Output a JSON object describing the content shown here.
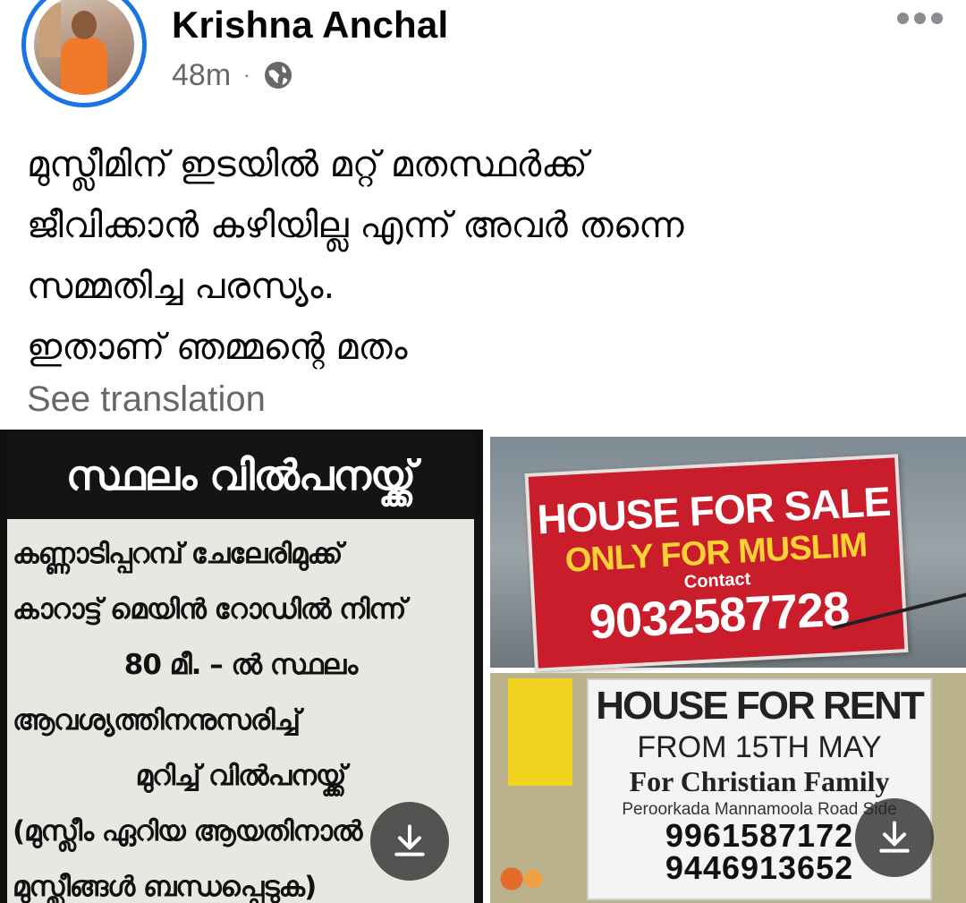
{
  "header": {
    "author_name": "Krishna Anchal",
    "time_ago": "48m",
    "separator": "·",
    "privacy_icon": "globe-icon",
    "more_icon": "more-options-icon",
    "accent_color": "#1b74e4"
  },
  "post": {
    "text_lines": [
      "മുസ്ലീമിന് ഇടയിൽ മറ്റ് മതസ്ഥർക്ക്",
      "ജീവിക്കാൻ കഴിയില്ല എന്ന് അവർ തന്നെ",
      "സമ്മതിച്ച പരസ്യം.",
      "ഇതാണ് ഞമ്മന്റെ മതം"
    ],
    "see_translation": "See translation"
  },
  "images": {
    "left": {
      "heading": "സ്ഥലം വിൽപനയ്ക്ക്",
      "lines": [
        "കണ്ണാടിപ്പറമ്പ് ചേലേരിമുക്ക്",
        "കാറാട്ട് മെയിൻ റോഡിൽ നിന്ന്",
        "80 മീ. – ൽ സ്ഥലം",
        "ആവശ്യത്തിനനുസരിച്ച്",
        "മുറിച്ച് വിൽപനയ്ക്ക്",
        "(മുസ്ലീം ഏറിയ ആയതിനാൽ",
        "മുസ്ലീങ്ങൾ ബന്ധപ്പെടുക)"
      ]
    },
    "right_top": {
      "line1": "HOUSE FOR SALE",
      "line2": "ONLY FOR MUSLIM",
      "line3": "Contact",
      "line4": "9032587728"
    },
    "right_bottom": {
      "line1": "HOUSE FOR RENT",
      "line2": "FROM 15TH MAY",
      "line3": "For Christian Family",
      "line4": "Peroorkada Mannamoola Road Side",
      "line5": "9961587172",
      "line6": "9446913652"
    },
    "download_icon": "download-icon"
  }
}
